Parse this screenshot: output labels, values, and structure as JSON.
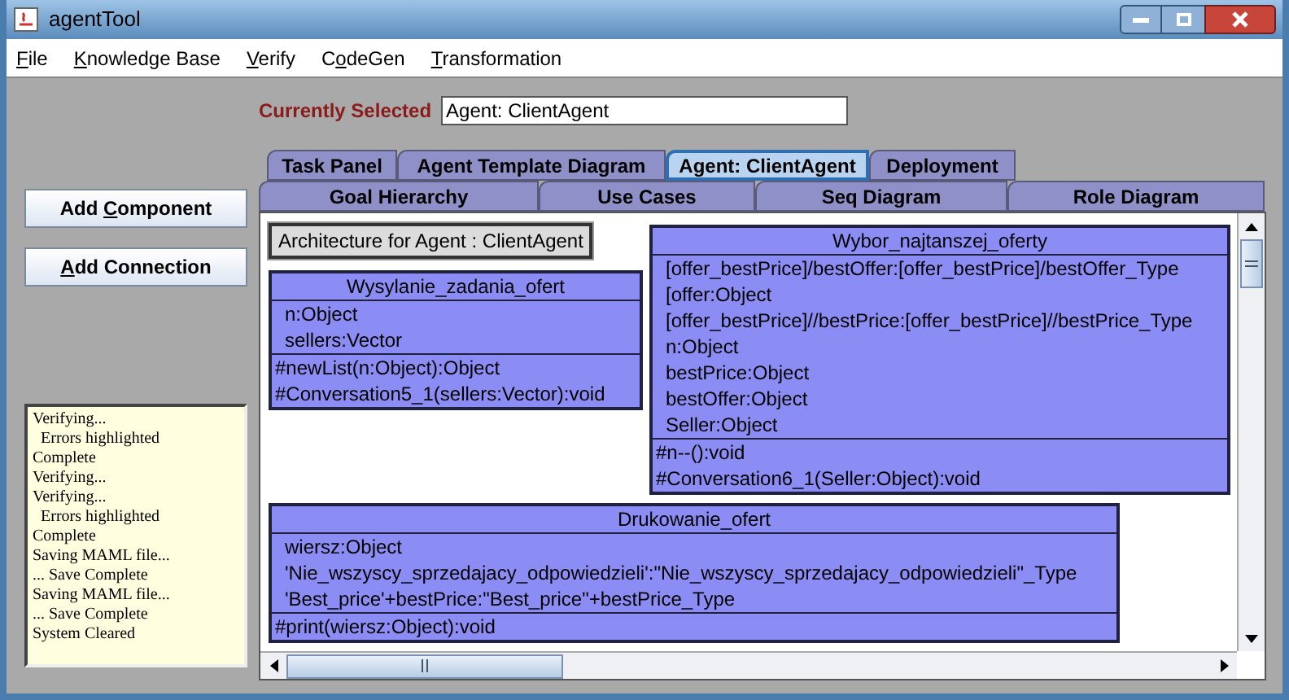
{
  "window": {
    "title": "agentTool"
  },
  "menu": [
    {
      "label": "File"
    },
    {
      "label": "Knowledge Base"
    },
    {
      "label": "Verify"
    },
    {
      "label": "CodeGen"
    },
    {
      "label": "Transformation"
    }
  ],
  "buttons": [
    {
      "label": "Add Component"
    },
    {
      "label": "Add Connection"
    }
  ],
  "log": [
    "Verifying...",
    "  Errors highlighted",
    "Complete",
    "Verifying...",
    "Verifying...",
    "  Errors highlighted",
    "Complete",
    "Saving MAML file...",
    "... Save Complete",
    "Saving MAML file...",
    "... Save Complete",
    "System Cleared"
  ],
  "currently_selected": {
    "label": "Currently Selected",
    "value": "Agent: ClientAgent"
  },
  "tabs_row1": [
    {
      "label": "Task Panel",
      "selected": false
    },
    {
      "label": "Agent Template Diagram",
      "selected": false
    },
    {
      "label": "Agent: ClientAgent",
      "selected": true
    },
    {
      "label": "Deployment",
      "selected": false
    }
  ],
  "tabs_row2": [
    {
      "label": "Goal Hierarchy",
      "selected": false
    },
    {
      "label": "Use Cases",
      "selected": false
    },
    {
      "label": "Seq Diagram",
      "selected": false
    },
    {
      "label": "Role Diagram",
      "selected": false
    }
  ],
  "diagram": {
    "title": "Architecture for Agent : ClientAgent",
    "classes": [
      {
        "name": "Wysylanie_zadania_ofert",
        "attributes": [
          "n:Object",
          "sellers:Vector"
        ],
        "methods": [
          "#newList(n:Object):Object",
          "#Conversation5_1(sellers:Vector):void"
        ]
      },
      {
        "name": "Wybor_najtanszej_oferty",
        "attributes": [
          "[offer_bestPrice]/bestOffer:[offer_bestPrice]/bestOffer_Type",
          "[offer:Object",
          "[offer_bestPrice]//bestPrice:[offer_bestPrice]//bestPrice_Type",
          "n:Object",
          "bestPrice:Object",
          "bestOffer:Object",
          "Seller:Object"
        ],
        "methods": [
          "#n--():void",
          "#Conversation6_1(Seller:Object):void"
        ]
      },
      {
        "name": "Drukowanie_ofert",
        "attributes": [
          "wiersz:Object",
          "'Nie_wszyscy_sprzedajacy_odpowiedzieli':\"Nie_wszyscy_sprzedajacy_odpowiedzieli\"_Type",
          "'Best_price'+bestPrice:\"Best_price\"+bestPrice_Type"
        ],
        "methods": [
          "#print(wiersz:Object):void"
        ]
      }
    ]
  }
}
